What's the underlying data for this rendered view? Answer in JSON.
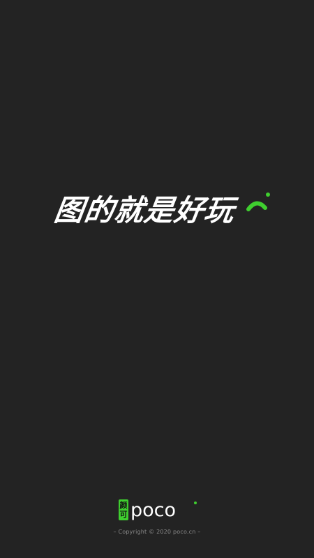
{
  "splash": {
    "slogan": "图的就是好玩",
    "brand_badge": [
      "颜",
      "可"
    ],
    "brand_name": "poco",
    "copyright": "– Copyright © 2020 poco.cn –"
  },
  "colors": {
    "background": "#232323",
    "accent": "#3fcf2f",
    "text": "#ffffff",
    "muted": "#8a8a8a"
  },
  "icons": {
    "slogan_mark": "signal-arc-icon",
    "brand_logo": "poco-logo"
  }
}
